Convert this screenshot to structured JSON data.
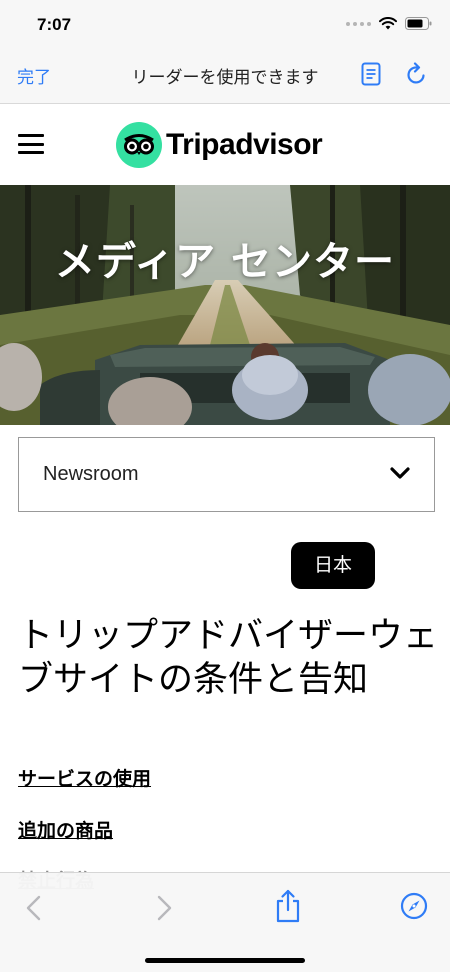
{
  "status_bar": {
    "time": "7:07"
  },
  "safari": {
    "done_label": "完了",
    "reader_message": "リーダーを使用できます"
  },
  "header": {
    "logo_text": "Tripadvisor"
  },
  "hero": {
    "title": "メディア センター"
  },
  "dropdown": {
    "selected": "Newsroom"
  },
  "language_badge": "日本",
  "page_title": "トリップアドバイザーウェブサイトの条件と告知",
  "links": [
    "サービスの使用",
    "追加の商品",
    "禁止行為"
  ],
  "colors": {
    "ios_blue": "#2f7cf6",
    "tripadvisor_green": "#34e0a1"
  }
}
